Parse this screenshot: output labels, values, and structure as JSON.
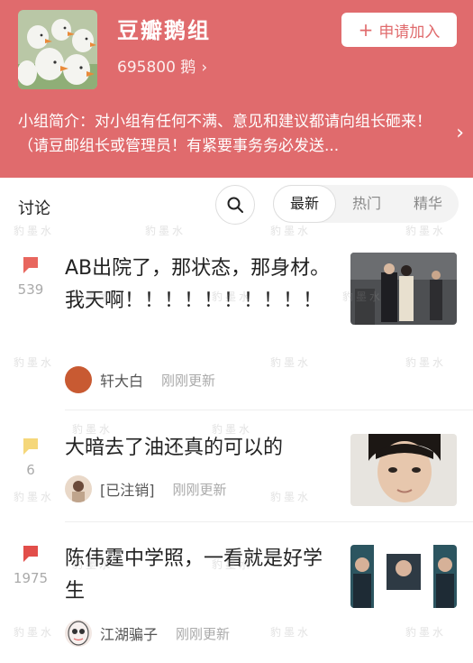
{
  "group": {
    "name": "豆瓣鹅组",
    "members": "695800 鹅",
    "join_label": "申请加入",
    "intro": "小组简介：对小组有任何不满、意见和建议都请向组长砸来！（请豆邮组长或管理员！有紧要事务务必发送..."
  },
  "tabs": {
    "title": "讨论",
    "sort": [
      "最新",
      "热门",
      "精华"
    ],
    "active": "最新"
  },
  "posts": [
    {
      "title": "AB出院了，那状态，那身材。我天啊！！！！！！！！！！",
      "count": "539",
      "author": "轩大白",
      "time": "刚刚更新",
      "flag_color": "#e8665e"
    },
    {
      "title": "大暗去了油还真的可以的",
      "count": "6",
      "author": "[已注销]",
      "time": "刚刚更新",
      "flag_color": "#f5d77a"
    },
    {
      "title": "陈伟霆中学照，一看就是好学生",
      "count": "1975",
      "author": "江湖骗子",
      "time": "刚刚更新",
      "flag_color": "#e24e4a"
    }
  ],
  "watermark": "豹墨水",
  "colors": {
    "header": "#e06b6d",
    "accent": "#e06b6d"
  }
}
